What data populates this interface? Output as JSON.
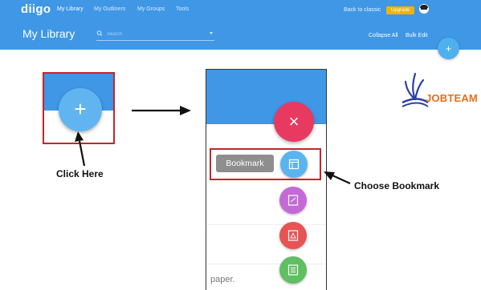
{
  "header": {
    "logo": "diigo",
    "nav": [
      "My Library",
      "My Outliners",
      "My Groups",
      "Tools"
    ],
    "back_to_classic": "Back to classic",
    "upgrade": "Upgrade",
    "page_title": "My Library",
    "search_placeholder": "Search",
    "collapse_all": "Collapse All",
    "bulk_edit": "Bulk Edit",
    "fab_symbol": "+"
  },
  "annotations": {
    "left_fab_symbol": "+",
    "click_here": "Click Here",
    "choose_bookmark": "Choose Bookmark"
  },
  "panel": {
    "close_symbol": "×",
    "bookmark_label": "Bookmark",
    "paper_text": "paper."
  },
  "watermark": {
    "text": "JOBTEAM"
  },
  "colors": {
    "header_blue": "#3f97e6",
    "close_fab": "#e83a60",
    "bookmark_fab": "#5cb4ef",
    "note_fab": "#c36ad6",
    "pdf_fab": "#e65453",
    "doc_fab": "#5fbf63",
    "highlight_red": "#c0272d",
    "upgrade_yellow": "#f4b000"
  },
  "icons": {
    "search": "search-icon",
    "bookmark": "bookmark-icon",
    "note": "note-icon",
    "pdf": "pdf-icon",
    "doc": "document-icon",
    "close": "close-icon",
    "add": "plus-icon"
  }
}
